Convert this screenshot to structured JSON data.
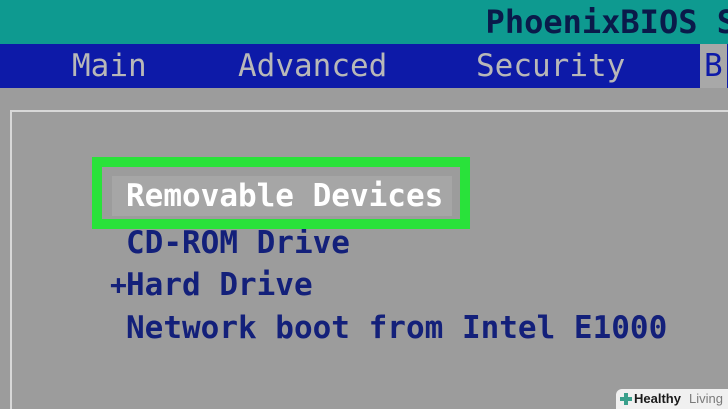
{
  "header": {
    "title": "PhoenixBIOS S"
  },
  "menu": {
    "tabs": [
      {
        "label": "Main"
      },
      {
        "label": "Advanced"
      },
      {
        "label": "Security"
      },
      {
        "label": "B"
      }
    ]
  },
  "boot_menu": {
    "selected": "Removable Devices",
    "items": [
      {
        "prefix": "",
        "label": "CD-ROM Drive"
      },
      {
        "prefix": "+",
        "label": "Hard Drive"
      },
      {
        "prefix": "",
        "label": "Network boot from Intel E1000"
      }
    ]
  },
  "watermark": {
    "text_a": "Healthy",
    "text_b": "Living"
  },
  "colors": {
    "titlebar": "#0e9a90",
    "menubar": "#0d1aa8",
    "background": "#9c9c9c",
    "highlight": "#29e23a",
    "item_text": "#13207a"
  }
}
